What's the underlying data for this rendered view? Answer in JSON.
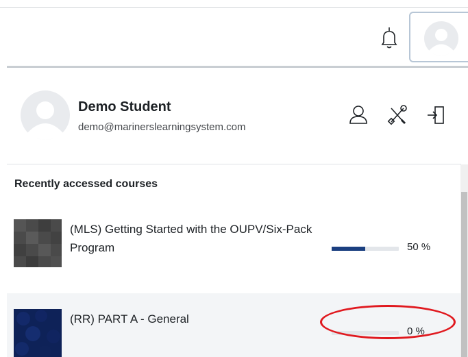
{
  "user": {
    "name": "Demo Student",
    "email": "demo@marinerslearningsystem.com"
  },
  "header_icons": [
    "profile-icon",
    "preferences-icon",
    "logout-icon"
  ],
  "recent_courses": {
    "title": "Recently accessed courses",
    "items": [
      {
        "name": "(MLS) Getting Started with the OUPV/Six-Pack Program",
        "progress": 50,
        "progress_label": "50 %",
        "thumb_color": "#4a4a4a"
      },
      {
        "name": "(RR) PART A - General",
        "progress": 0,
        "progress_label": "0 %",
        "thumb_color": "#0e2258"
      }
    ]
  },
  "colors": {
    "progress_fill": "#1b3f80",
    "annotation": "#e0191f"
  }
}
